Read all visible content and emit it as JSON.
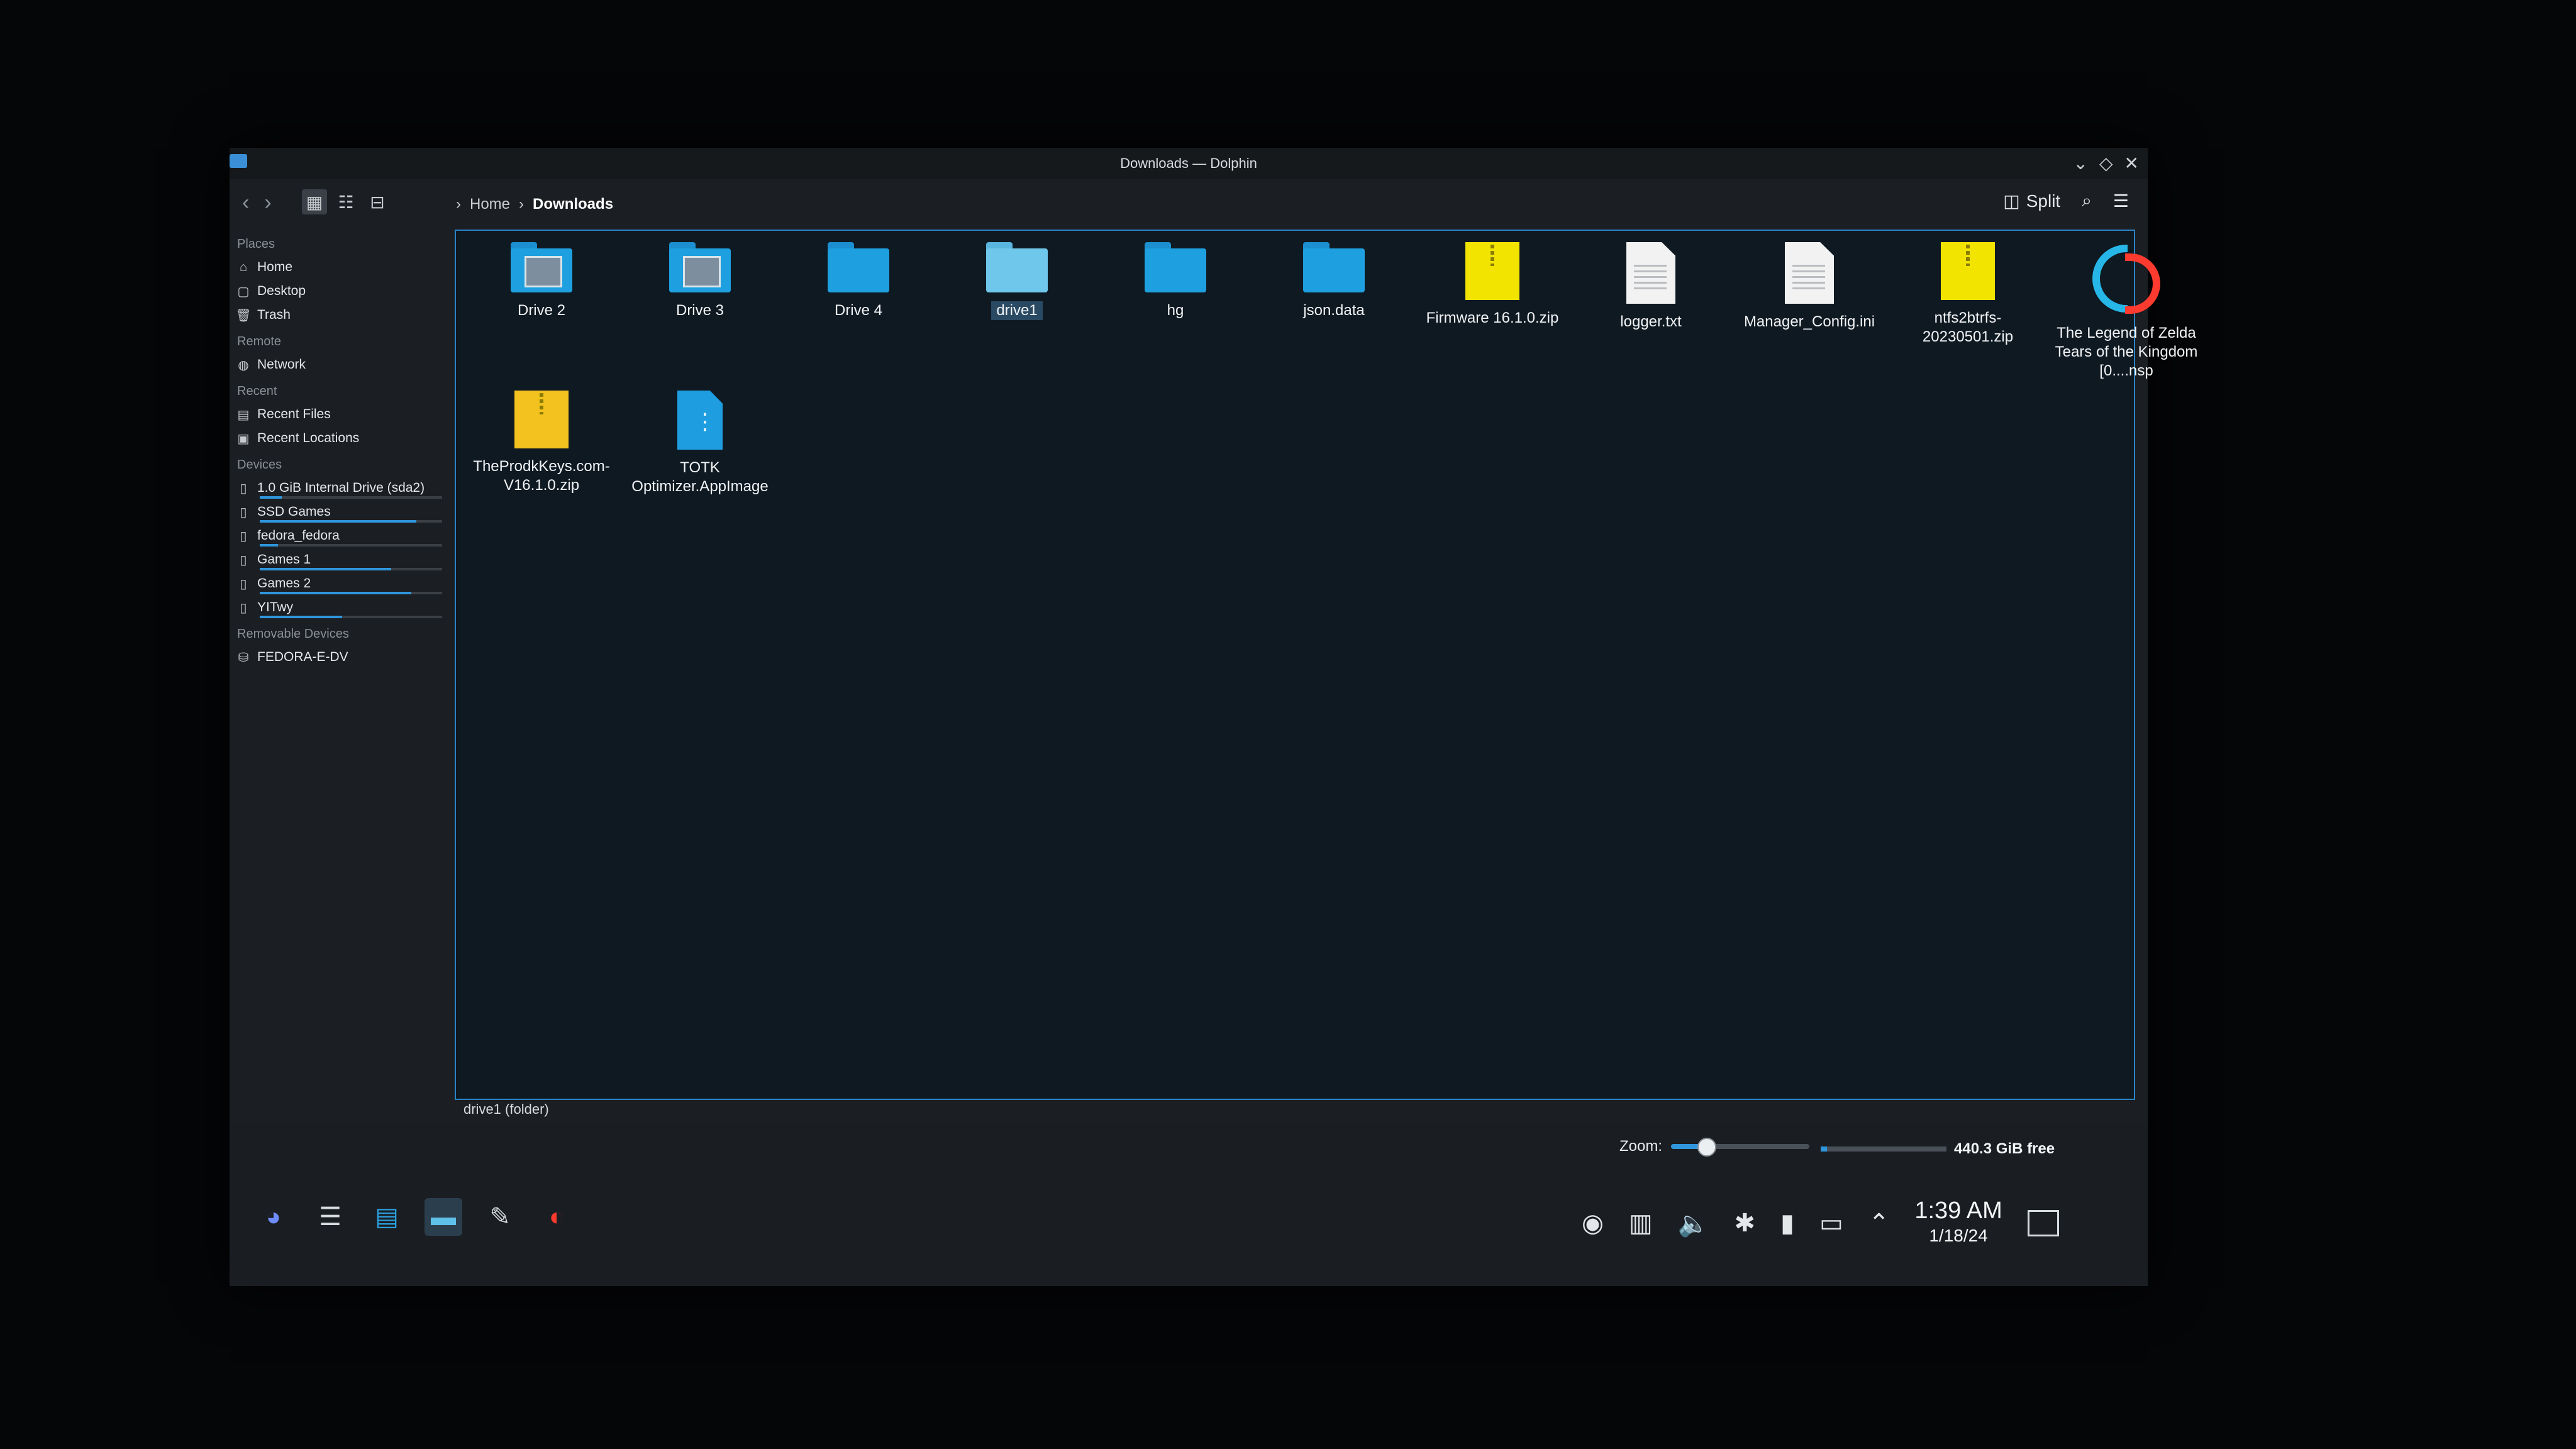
{
  "window": {
    "title": "Downloads — Dolphin"
  },
  "toolbar": {
    "breadcrumb": [
      "Home",
      "Downloads"
    ],
    "split_label": "Split"
  },
  "sidebar": {
    "sections": {
      "places": "Places",
      "remote": "Remote",
      "recent": "Recent",
      "devices": "Devices",
      "removable": "Removable Devices"
    },
    "places": [
      {
        "label": "Home",
        "icon": "home-icon"
      },
      {
        "label": "Desktop",
        "icon": "desktop-icon"
      },
      {
        "label": "Trash",
        "icon": "trash-icon"
      }
    ],
    "remote": [
      {
        "label": "Network",
        "icon": "network-icon"
      }
    ],
    "recent": [
      {
        "label": "Recent Files",
        "icon": "recent-files-icon"
      },
      {
        "label": "Recent Locations",
        "icon": "recent-locations-icon"
      }
    ],
    "devices": [
      {
        "label": "1.0 GiB Internal Drive (sda2)",
        "usage": 0.12
      },
      {
        "label": "SSD Games",
        "usage": 0.86
      },
      {
        "label": "fedora_fedora",
        "usage": 0.1
      },
      {
        "label": "Games 1",
        "usage": 0.72
      },
      {
        "label": "Games 2",
        "usage": 0.83
      },
      {
        "label": "YITwy",
        "usage": 0.45
      }
    ],
    "removable": [
      {
        "label": "FEDORA-E-DV",
        "icon": "usb-drive-icon"
      }
    ]
  },
  "files": [
    {
      "name": "Drive 2",
      "type": "folder-picture"
    },
    {
      "name": "Drive 3",
      "type": "folder-picture"
    },
    {
      "name": "Drive 4",
      "type": "folder"
    },
    {
      "name": "drive1",
      "type": "folder-selected"
    },
    {
      "name": "hg",
      "type": "folder"
    },
    {
      "name": "json.data",
      "type": "folder"
    },
    {
      "name": "Firmware 16.1.0.zip",
      "type": "zip"
    },
    {
      "name": "logger.txt",
      "type": "text"
    },
    {
      "name": "Manager_Config.ini",
      "type": "text"
    },
    {
      "name": "ntfs2btrfs-20230501.zip",
      "type": "zip"
    },
    {
      "name": "The Legend of Zelda Tears of the Kingdom [0....nsp",
      "type": "yuzu"
    },
    {
      "name": "TheProdkKeys.com-V16.1.0.zip",
      "type": "zip-amber"
    },
    {
      "name": "TOTK Optimizer.AppImage",
      "type": "appimage"
    }
  ],
  "status": {
    "selection": "drive1 (folder)",
    "zoom_label": "Zoom:",
    "zoom_level": 0.25,
    "free_space": "440.3 GiB free",
    "used_fraction": 0.05
  },
  "clock": {
    "time": "1:39 AM",
    "date": "1/18/24"
  }
}
